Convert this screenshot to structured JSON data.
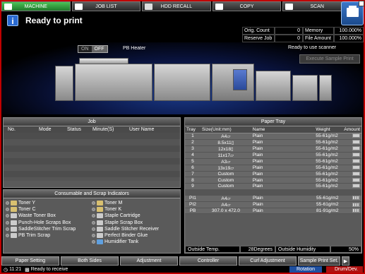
{
  "tabs": [
    {
      "label": "MACHINE",
      "active": true
    },
    {
      "label": "JOB LIST",
      "active": false
    },
    {
      "label": "HDD RECALL",
      "active": false
    },
    {
      "label": "COPY",
      "active": false
    },
    {
      "label": "SCAN",
      "active": false
    }
  ],
  "status": {
    "icon": "info-icon",
    "text": "Ready to print"
  },
  "counters": {
    "orig_count_label": "Orig. Count",
    "orig_count_value": "0",
    "memory_label": "Memory",
    "memory_value": "100.000%",
    "reserve_job_label": "Reserve Job",
    "reserve_job_value": "0",
    "file_amount_label": "File Amount",
    "file_amount_value": "100.000%"
  },
  "machine": {
    "on_label": "ON",
    "off_label": "OFF",
    "off_selected": true,
    "pb_heater_label": "PB Heater",
    "scanner_status": "Ready to use scanner",
    "execute_sample_print_label": "Execute Sample Print"
  },
  "job_panel": {
    "title": "Job",
    "columns": [
      "No.",
      "Mode",
      "Status",
      "Minute(S)",
      "User Name"
    ]
  },
  "consumables_panel": {
    "title": "Consumable and Scrap Indicators",
    "items": [
      {
        "label": "Toner Y",
        "icon": "toner-icon"
      },
      {
        "label": "Toner M",
        "icon": "toner-icon"
      },
      {
        "label": "Toner C",
        "icon": "toner-icon"
      },
      {
        "label": "Toner K",
        "icon": "toner-icon"
      },
      {
        "label": "Waste Toner Box",
        "icon": "waste-box-icon"
      },
      {
        "label": "Staple Cartridge",
        "icon": "staple-icon"
      },
      {
        "label": "Punch-Hole Scraps Box",
        "icon": "punch-icon"
      },
      {
        "label": "Staple Scrap Box",
        "icon": "staple-icon"
      },
      {
        "label": "SaddleStitcher Trim Scrap",
        "icon": "trim-icon"
      },
      {
        "label": "Saddle Stitcher Receiver",
        "icon": "staple-icon"
      },
      {
        "label": "PB Trim Scrap",
        "icon": "trim-icon"
      },
      {
        "label": "Perfect Binder Glue",
        "icon": "glue-icon"
      },
      {
        "label": "",
        "icon": ""
      },
      {
        "label": "Humidifier Tank",
        "icon": "tank-icon"
      }
    ]
  },
  "paper_tray_panel": {
    "title": "Paper Tray",
    "columns": [
      "Tray",
      "Size(Unit:mm)",
      "Name",
      "Weight",
      "Amount"
    ],
    "rows": [
      {
        "tray": "1",
        "size": "A4▱",
        "name": "Plain",
        "weight": "55-61g/m2"
      },
      {
        "tray": "2",
        "size": "8.5x11▯",
        "name": "Plain",
        "weight": "55-61g/m2"
      },
      {
        "tray": "3",
        "size": "12x18▯",
        "name": "Plain",
        "weight": "55-61g/m2"
      },
      {
        "tray": "4",
        "size": "11x17▱",
        "name": "Plain",
        "weight": "55-61g/m2"
      },
      {
        "tray": "5",
        "size": "A3▱",
        "name": "Plain",
        "weight": "55-61g/m2"
      },
      {
        "tray": "6",
        "size": "13x19▱",
        "name": "Plain",
        "weight": "55-61g/m2"
      },
      {
        "tray": "7",
        "size": "Custom",
        "name": "Plain",
        "weight": "55-61g/m2"
      },
      {
        "tray": "8",
        "size": "Custom",
        "name": "Plain",
        "weight": "55-61g/m2"
      },
      {
        "tray": "9",
        "size": "Custom",
        "name": "Plain",
        "weight": "55-61g/m2"
      }
    ],
    "extra_rows": [
      {
        "tray": "PI1",
        "size": "A4▱",
        "name": "Plain",
        "weight": "55-61g/m2"
      },
      {
        "tray": "PI2",
        "size": "A4▱",
        "name": "Plain",
        "weight": "55-61g/m2"
      },
      {
        "tray": "PB",
        "size": "307.0 x 472.0",
        "name": "Plain",
        "weight": "81-91g/m2"
      }
    ],
    "outside_temp_label": "Outside Temp.",
    "outside_temp_value": "28Degrees",
    "outside_humidity_label": "Outside Humidity",
    "outside_humidity_value": "50%"
  },
  "bottom_buttons": [
    "Paper Setting",
    "Both Sides",
    "Adjustment",
    "Controller",
    "Curl Adjustment",
    "Sample Print Set."
  ],
  "statusbar": {
    "time": "11:21",
    "message": "Ready to receive",
    "rotation_label": "Rotation",
    "drum_label": "Drum/Dev."
  },
  "colors": {
    "active_tab": "#2fa03a",
    "alert_frame": "#c00000",
    "rotation": "#1e4fa0",
    "drum": "#b01010"
  }
}
